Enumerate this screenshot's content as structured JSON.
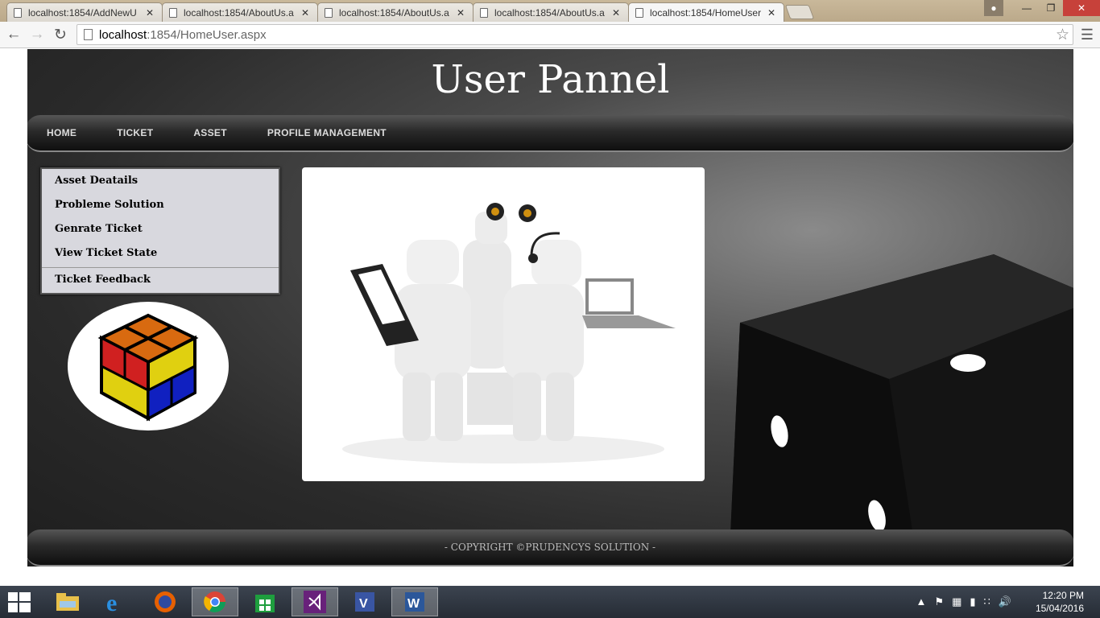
{
  "browser": {
    "tabs": [
      {
        "title": "localhost:1854/AddNewU"
      },
      {
        "title": "localhost:1854/AboutUs.a"
      },
      {
        "title": "localhost:1854/AboutUs.a"
      },
      {
        "title": "localhost:1854/AboutUs.a"
      },
      {
        "title": "localhost:1854/HomeUser"
      }
    ],
    "active_tab_index": 4,
    "url_host": "localhost",
    "url_path": ":1854/HomeUser.aspx"
  },
  "site": {
    "title": "User Pannel",
    "nav": [
      "HOME",
      "TICKET",
      "ASSET",
      "PROFILE MANAGEMENT"
    ],
    "side_menu": [
      "Asset Deatails",
      "Probleme Solution",
      "Genrate Ticket",
      "View Ticket State",
      "Ticket Feedback"
    ],
    "footer": "- COPYRIGHT ©PRUDENCYS SOLUTION -"
  },
  "taskbar": {
    "apps": [
      "start-icon",
      "file-explorer-icon",
      "internet-explorer-icon",
      "firefox-icon",
      "chrome-icon",
      "store-icon",
      "visual-studio-icon",
      "visio-icon",
      "word-icon"
    ],
    "time": "12:20 PM",
    "date": "15/04/2016"
  }
}
